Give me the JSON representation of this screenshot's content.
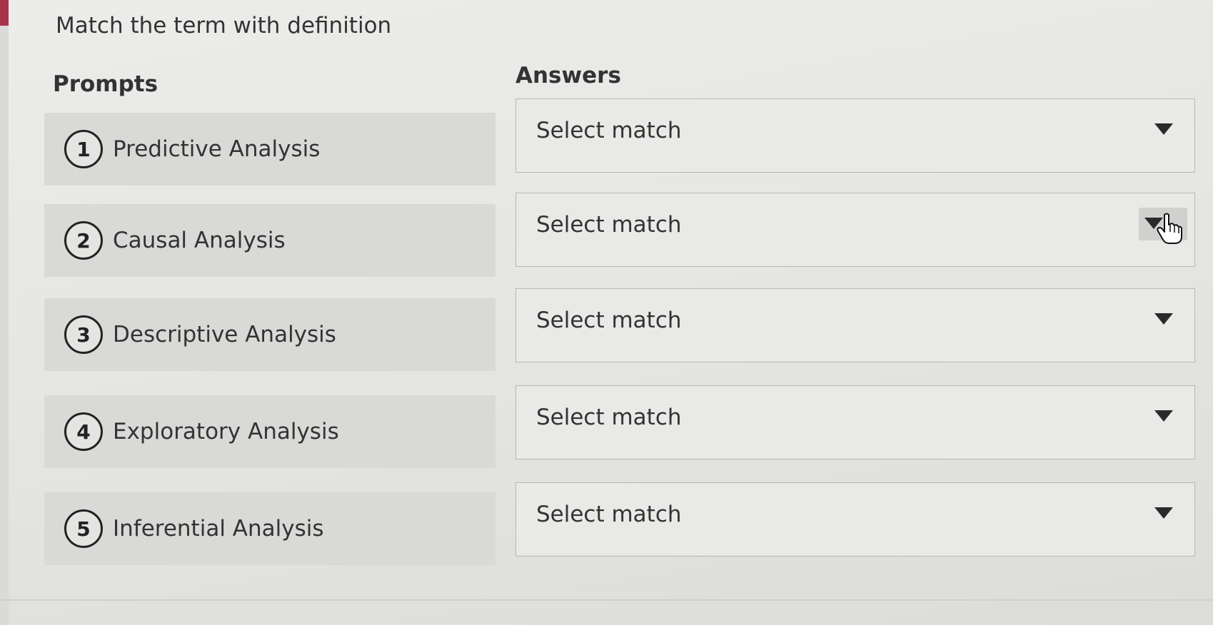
{
  "question": {
    "instructions": "Match the term with definition"
  },
  "columns": {
    "prompts_heading": "Prompts",
    "answers_heading": "Answers"
  },
  "prompts": [
    {
      "number": "1",
      "label": "Predictive Analysis"
    },
    {
      "number": "2",
      "label": "Causal Analysis"
    },
    {
      "number": "3",
      "label": "Descriptive Analysis"
    },
    {
      "number": "4",
      "label": "Exploratory Analysis"
    },
    {
      "number": "5",
      "label": "Inferential Analysis"
    }
  ],
  "answers": [
    {
      "selected": "Select match",
      "icon": "chevron-down-icon"
    },
    {
      "selected": "Select match",
      "icon": "chevron-down-icon",
      "hovered": true
    },
    {
      "selected": "Select match",
      "icon": "chevron-down-icon"
    },
    {
      "selected": "Select match",
      "icon": "chevron-down-icon"
    },
    {
      "selected": "Select match",
      "icon": "chevron-down-icon"
    }
  ],
  "colors": {
    "accent_tab": "#a8344a",
    "prompt_row_bg": "#d9d9d7",
    "select_bg": "#e9e9e7"
  }
}
